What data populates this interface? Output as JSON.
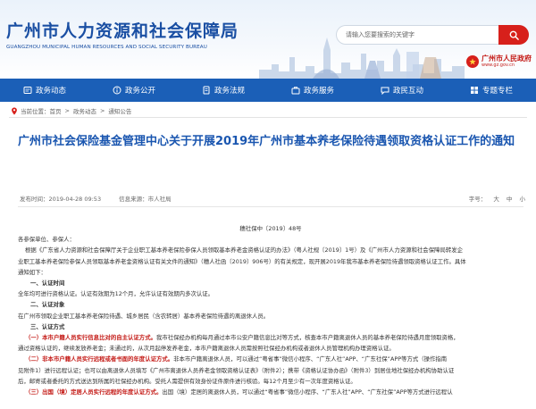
{
  "header": {
    "logo_cn": "广州市人力资源和社会保障局",
    "logo_en": "GUANGZHOU MUNICIPAL HUMAN RESOURCES AND SOCIAL SECURITY BUREAU",
    "search_placeholder": "请输入您要搜索的关键字",
    "gov_cn": "广州市人民政府",
    "gov_en": "www.gz.gov.cn"
  },
  "nav": [
    {
      "label": "政务动态",
      "icon": "news-icon"
    },
    {
      "label": "政务公开",
      "icon": "info-icon"
    },
    {
      "label": "政务法规",
      "icon": "law-icon"
    },
    {
      "label": "政务服务",
      "icon": "service-icon"
    },
    {
      "label": "政民互动",
      "icon": "chat-icon"
    },
    {
      "label": "专题专栏",
      "icon": "topic-icon"
    }
  ],
  "breadcrumb": {
    "label": "当前位置：",
    "items": [
      "首页",
      "政务动态",
      "通知公告"
    ]
  },
  "article": {
    "title": "广州市社会保险基金管理中心关于开展2019年广州市基本养老保险待遇领取资格认证工作的通知",
    "date": "发布时间：2019-04-28 09:53",
    "source": "信息来源：市人社局",
    "font_size_label": "字号：",
    "font_sizes": [
      "大",
      "中",
      "小"
    ],
    "doc_no": "穗社保中〔2019〕48号",
    "greeting": "各参保单位、参保人：",
    "paragraphs": [
      "根据《广东省人力资源和社会保障厅关于企业职工基本养老保险参保人员领取基本养老金资格认证的办法》（粤人社规〔2019〕1号）及《广州市人力资源和社会保障局转发企",
      "业职工基本养老保险参保人员领取基本养老金资格认证有关文件的通知》（穗人社函〔2019〕906号）的有关规定，现开展2019年我市基本养老保险待遇领取资格认证工作。具体",
      "通知如下："
    ],
    "section1_title": "一、认证时间",
    "section1_text": "全年均可进行资格认证。认证有效期为12个月，允许认证有效期内多次认证。",
    "section2_title": "二、认证对象",
    "section2_text": "在广州市领取企业职工基本养老保险待遇、城乡居民（含农转居）基本养老保险待遇的离退休人员。",
    "section3_title": "三、认证方式",
    "method1_head": "（一）本市户籍人员实行信息比对的自主认证方式。",
    "method1_text": "我市社保经办机构每月通过本市公安户籍信息比对等方式，核查本市户籍离退休人员的基本养老保险待遇月度领取资格，",
    "method1_text2": "通过资格认证的，继续发放养老金；未通过的，从次月起停发养老金，本市户籍离退休人员需按照社保经办机构或者退休人员管理机构办理资格认证。",
    "method2_head": "（二）非本市户籍人员实行远程或者书面的年度认证方式。",
    "method2_text": "非本市户籍离退休人员，可以通过“粤省事”微信小程序、“广东人社”APP、“广东社保”APP等方式（操作指南",
    "method2_text2": "见附件1）进行远程认证；也可以由离退休人员填写《广州市离退休人员养老金领取资格认证表》（附件2）；携带《资格认证协办函》（附件3）到居住地社保经办机构协助认证",
    "method2_text3": "后，邮寄或者委托的方式送达到所属的社保经办机构。受托人需提供有效身份证件原件进行核验。每12个月至少有一次年度资格认证。",
    "method3_head": "（三）出国（境）定居人员实行远程的年度认证方式。",
    "method3_text": "出国（境）定居的离退休人员，可以通过“粤省事”微信小程序、“广东人社”APP、“广东社保”APP等方式进行远程认"
  }
}
